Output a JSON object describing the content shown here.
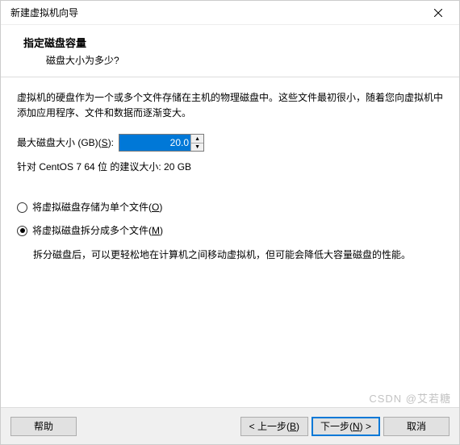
{
  "window": {
    "title": "新建虚拟机向导"
  },
  "header": {
    "title": "指定磁盘容量",
    "subtitle": "磁盘大小为多少?"
  },
  "desc": "虚拟机的硬盘作为一个或多个文件存储在主机的物理磁盘中。这些文件最初很小，随着您向虚拟机中添加应用程序、文件和数据而逐渐变大。",
  "size": {
    "label_prefix": "最大磁盘大小 (GB)(",
    "label_accel": "S",
    "label_suffix": "):",
    "value": "20.0"
  },
  "recommend": "针对 CentOS 7 64 位 的建议大小: 20 GB",
  "radios": {
    "single": {
      "prefix": "将虚拟磁盘存储为单个文件(",
      "accel": "O",
      "suffix": ")",
      "checked": false
    },
    "split": {
      "prefix": "将虚拟磁盘拆分成多个文件(",
      "accel": "M",
      "suffix": ")",
      "checked": true
    },
    "split_desc": "拆分磁盘后，可以更轻松地在计算机之间移动虚拟机，但可能会降低大容量磁盘的性能。"
  },
  "buttons": {
    "help": "帮助",
    "back": {
      "prefix": "< 上一步(",
      "accel": "B",
      "suffix": ")"
    },
    "next": {
      "prefix": "下一步(",
      "accel": "N",
      "suffix": ") >"
    },
    "cancel": "取消"
  },
  "watermark": "CSDN @艾若糖"
}
